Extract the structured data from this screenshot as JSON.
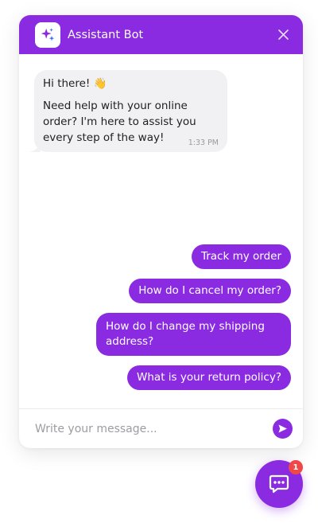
{
  "header": {
    "title": "Assistant Bot",
    "avatar_icon": "sparkles-icon",
    "close_icon": "close-icon"
  },
  "bot_message": {
    "line_1": "Hi there! 👋",
    "line_2": "Need help with your online order? I'm here to assist you every step of the way!",
    "time": "1:33 PM"
  },
  "suggestions": [
    "Track my order",
    "How do I cancel my order?",
    "How do I change my shipping address?",
    "What is your return policy?"
  ],
  "input": {
    "placeholder": "Write your message..."
  },
  "launcher": {
    "icon": "chat-dots-icon",
    "badge_count": "1"
  },
  "colors": {
    "accent": "#8a2be2",
    "bot_bubble": "#f1f1f4",
    "badge": "#f04747"
  }
}
